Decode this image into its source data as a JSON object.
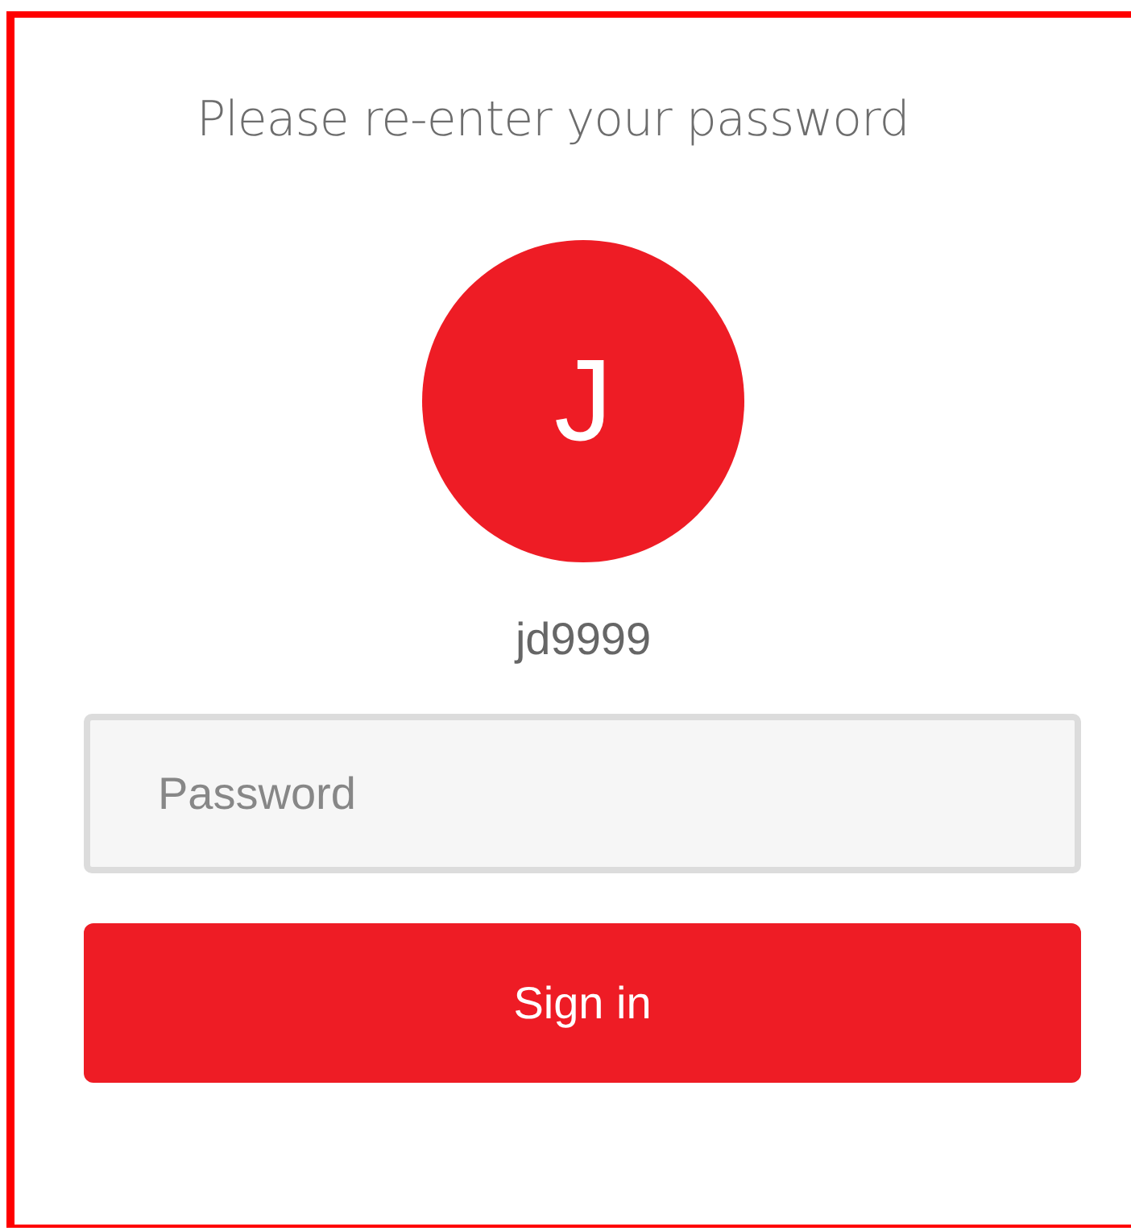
{
  "heading": "Please re-enter your password",
  "avatar": {
    "initial": "J",
    "color": "#ee1c25"
  },
  "username": "jd9999",
  "password_field": {
    "placeholder": "Password"
  },
  "buttons": [
    "Sign in"
  ]
}
